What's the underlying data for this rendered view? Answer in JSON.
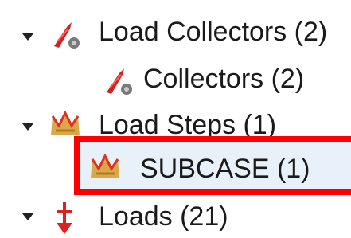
{
  "tree": {
    "items": [
      {
        "label": "Load Collectors (2)",
        "icon": "load-collector-icon",
        "expanded": true
      },
      {
        "label": "Collectors (2)",
        "icon": "load-collector-icon"
      },
      {
        "label": "Load Steps (1)",
        "icon": "load-step-icon",
        "expanded": true
      },
      {
        "label": "SUBCASE (1)",
        "icon": "load-step-icon",
        "selected": true
      },
      {
        "label": "Loads (21)",
        "icon": "load-icon",
        "expanded": true
      }
    ]
  },
  "colors": {
    "highlight_border": "#ff0000",
    "selection_background": "#e8f0f9",
    "text": "#1a1a1a"
  }
}
